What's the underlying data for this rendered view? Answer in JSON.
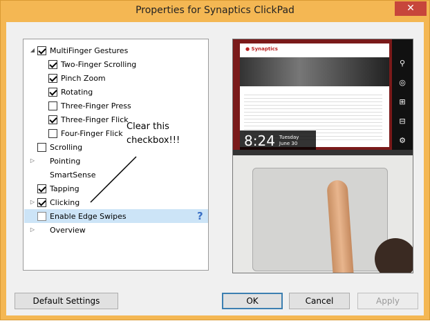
{
  "window": {
    "title": "Properties for Synaptics ClickPad",
    "close_glyph": "✕"
  },
  "tree": {
    "items": [
      {
        "label": "MultiFinger Gestures",
        "checked": true,
        "expander": "◢",
        "has_checkbox": true
      },
      {
        "label": "Two-Finger Scrolling",
        "checked": true,
        "has_checkbox": true
      },
      {
        "label": "Pinch Zoom",
        "checked": true,
        "has_checkbox": true
      },
      {
        "label": "Rotating",
        "checked": true,
        "has_checkbox": true
      },
      {
        "label": "Three-Finger Press",
        "checked": false,
        "has_checkbox": true
      },
      {
        "label": "Three-Finger Flick",
        "checked": true,
        "has_checkbox": true
      },
      {
        "label": "Four-Finger Flick",
        "checked": false,
        "has_checkbox": true
      },
      {
        "label": "Scrolling",
        "checked": false,
        "has_checkbox": true
      },
      {
        "label": "Pointing",
        "expander": "▷",
        "has_checkbox": false
      },
      {
        "label": "SmartSense",
        "has_checkbox": false
      },
      {
        "label": "Tapping",
        "checked": true,
        "has_checkbox": true
      },
      {
        "label": "Clicking",
        "checked": true,
        "expander": "▷",
        "has_checkbox": true
      },
      {
        "label": "Enable Edge Swipes",
        "checked": false,
        "has_checkbox": true,
        "selected": true,
        "help": "?"
      },
      {
        "label": "Overview",
        "expander": "▷",
        "has_checkbox": false
      }
    ]
  },
  "annotation": {
    "line1": "Clear this",
    "line2": "checkbox!!!"
  },
  "preview": {
    "clock_time": "8:24",
    "clock_day": "Tuesday",
    "clock_date": "June 30"
  },
  "buttons": {
    "default_settings": "Default Settings",
    "ok": "OK",
    "cancel": "Cancel",
    "apply": "Apply"
  },
  "colors": {
    "titlebar": "#f4b753",
    "close": "#c7463b",
    "selection": "#cce4f7",
    "help": "#3a6fc5"
  }
}
